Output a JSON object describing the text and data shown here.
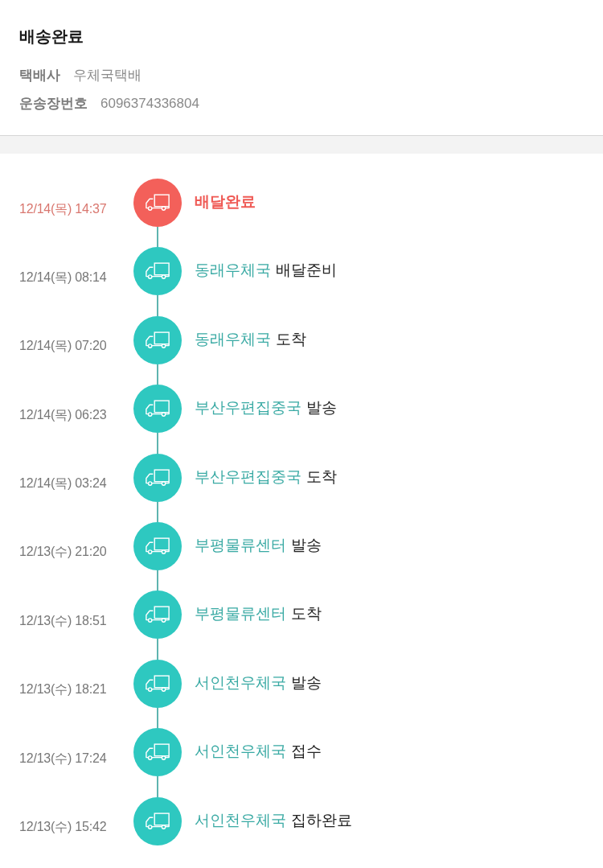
{
  "header": {
    "title": "배송완료",
    "fields": [
      {
        "label": "택배사",
        "value": "우체국택배"
      },
      {
        "label": "운송장번호",
        "value": "6096374336804"
      }
    ]
  },
  "timeline": [
    {
      "time": "12/14(목) 14:37",
      "status": "배달완료",
      "current": true
    },
    {
      "time": "12/14(목) 08:14",
      "location": "동래우체국",
      "status": "배달준비",
      "current": false
    },
    {
      "time": "12/14(목) 07:20",
      "location": "동래우체국",
      "status": "도착",
      "current": false
    },
    {
      "time": "12/14(목) 06:23",
      "location": "부산우편집중국",
      "status": "발송",
      "current": false
    },
    {
      "time": "12/14(목) 03:24",
      "location": "부산우편집중국",
      "status": "도착",
      "current": false
    },
    {
      "time": "12/13(수) 21:20",
      "location": "부평물류센터",
      "status": "발송",
      "current": false
    },
    {
      "time": "12/13(수) 18:51",
      "location": "부평물류센터",
      "status": "도착",
      "current": false
    },
    {
      "time": "12/13(수) 18:21",
      "location": "서인천우체국",
      "status": "발송",
      "current": false
    },
    {
      "time": "12/13(수) 17:24",
      "location": "서인천우체국",
      "status": "접수",
      "current": false
    },
    {
      "time": "12/13(수) 15:42",
      "location": "서인천우체국",
      "status": "집하완료",
      "current": false
    }
  ]
}
